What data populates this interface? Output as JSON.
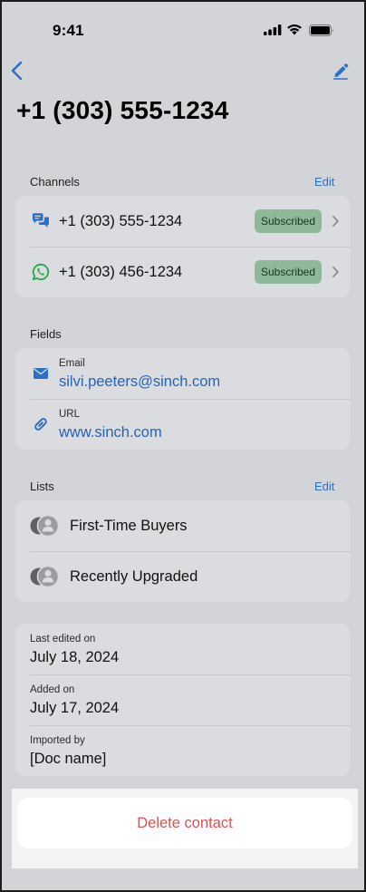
{
  "status": {
    "time": "9:41"
  },
  "header": {
    "title": "+1 (303) 555-1234"
  },
  "channels": {
    "label": "Channels",
    "edit_label": "Edit",
    "items": [
      {
        "icon": "chat-bubbles-icon",
        "number": "+1 (303) 555-1234",
        "status": "Subscribed"
      },
      {
        "icon": "whatsapp-icon",
        "number": "+1 (303) 456-1234",
        "status": "Subscribed"
      }
    ]
  },
  "fields": {
    "label": "Fields",
    "items": [
      {
        "icon": "envelope-icon",
        "label": "Email",
        "value": "silvi.peeters@sinch.com"
      },
      {
        "icon": "link-icon",
        "label": "URL",
        "value": "www.sinch.com"
      }
    ]
  },
  "lists": {
    "label": "Lists",
    "edit_label": "Edit",
    "items": [
      {
        "icon": "group-icon",
        "name": "First-Time Buyers"
      },
      {
        "icon": "group-icon",
        "name": "Recently Upgraded"
      }
    ]
  },
  "meta": {
    "items": [
      {
        "label": "Last edited on",
        "value": "July 18, 2024"
      },
      {
        "label": "Added on",
        "value": "July 17, 2024"
      },
      {
        "label": "Imported by",
        "value": "[Doc name]"
      }
    ]
  },
  "actions": {
    "delete_label": "Delete contact"
  },
  "colors": {
    "accent": "#2b6fc7",
    "link": "#2563b8",
    "danger": "#d9534f",
    "badge_bg": "#8fb89a",
    "whatsapp": "#27a844"
  }
}
